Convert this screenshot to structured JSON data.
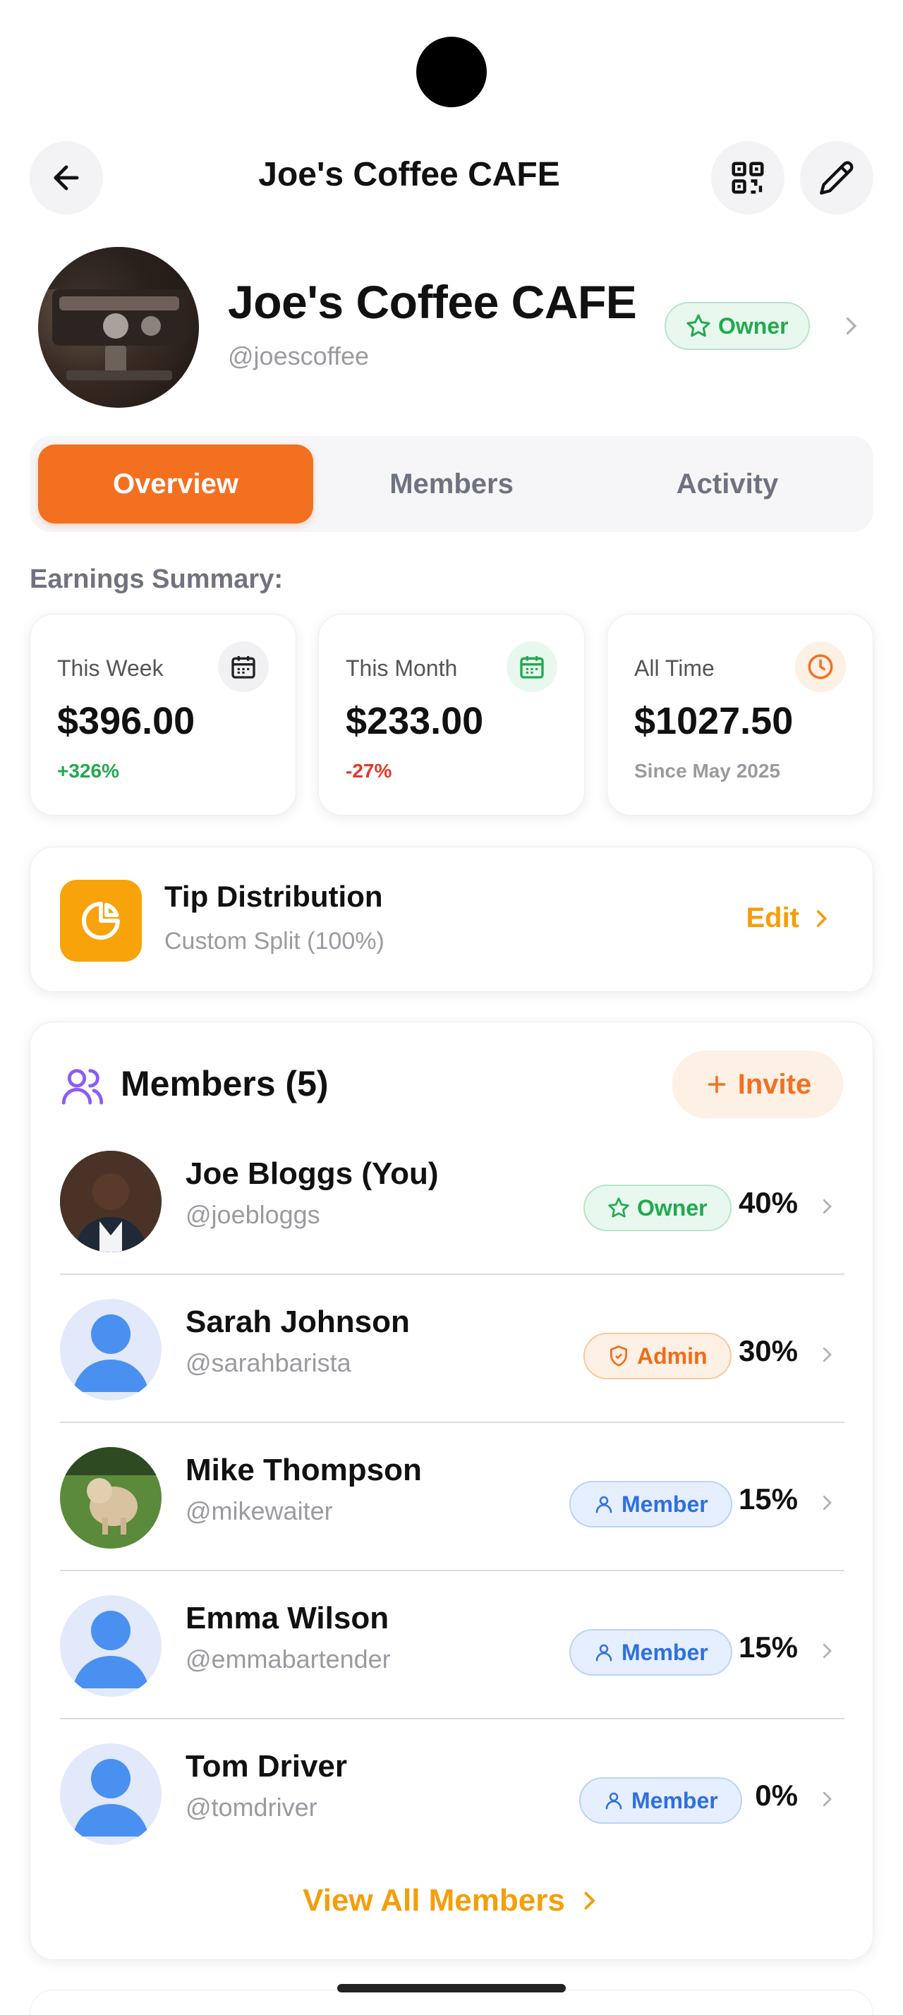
{
  "header": {
    "title": "Joe's Coffee CAFE"
  },
  "profile": {
    "name": "Joe's Coffee CAFE",
    "handle": "@joescoffee",
    "role": "Owner"
  },
  "tabs": [
    {
      "label": "Overview",
      "active": true
    },
    {
      "label": "Members",
      "active": false
    },
    {
      "label": "Activity",
      "active": false
    }
  ],
  "earnings": {
    "label": "Earnings Summary:",
    "cards": [
      {
        "label": "This Week",
        "value": "$396.00",
        "sub": "+326%",
        "sub_color": "#22a94f",
        "icon": "calendar-icon",
        "icon_bg": "#f1f1f3",
        "icon_color": "#222"
      },
      {
        "label": "This Month",
        "value": "$233.00",
        "sub": "-27%",
        "sub_color": "#e0392b",
        "icon": "calendar-icon",
        "icon_bg": "#e8f8ee",
        "icon_color": "#22a94f"
      },
      {
        "label": "All Time",
        "value": "$1027.50",
        "sub": "Since May 2025",
        "sub_color": "#9a9aa2",
        "icon": "clock-icon",
        "icon_bg": "#fdf0e4",
        "icon_color": "#f37021"
      }
    ]
  },
  "tip_distribution": {
    "title": "Tip Distribution",
    "subtitle": "Custom Split (100%)",
    "action": "Edit"
  },
  "members": {
    "title": "Members (5)",
    "invite_label": "Invite",
    "view_all_label": "View All Members",
    "items": [
      {
        "name": "Joe Bloggs (You)",
        "handle": "@joebloggs",
        "role": "Owner",
        "percent": "40%",
        "avatar": "photo-person"
      },
      {
        "name": "Sarah Johnson",
        "handle": "@sarahbarista",
        "role": "Admin",
        "percent": "30%",
        "avatar": "placeholder"
      },
      {
        "name": "Mike Thompson",
        "handle": "@mikewaiter",
        "role": "Member",
        "percent": "15%",
        "avatar": "photo-dog"
      },
      {
        "name": "Emma Wilson",
        "handle": "@emmabartender",
        "role": "Member",
        "percent": "15%",
        "avatar": "placeholder"
      },
      {
        "name": "Tom Driver",
        "handle": "@tomdriver",
        "role": "Member",
        "percent": "0%",
        "avatar": "placeholder"
      }
    ]
  },
  "colors": {
    "accent_orange": "#f37021",
    "accent_amber": "#f59e0b",
    "owner_green": "#22a94f",
    "member_blue": "#2f6fe0"
  }
}
